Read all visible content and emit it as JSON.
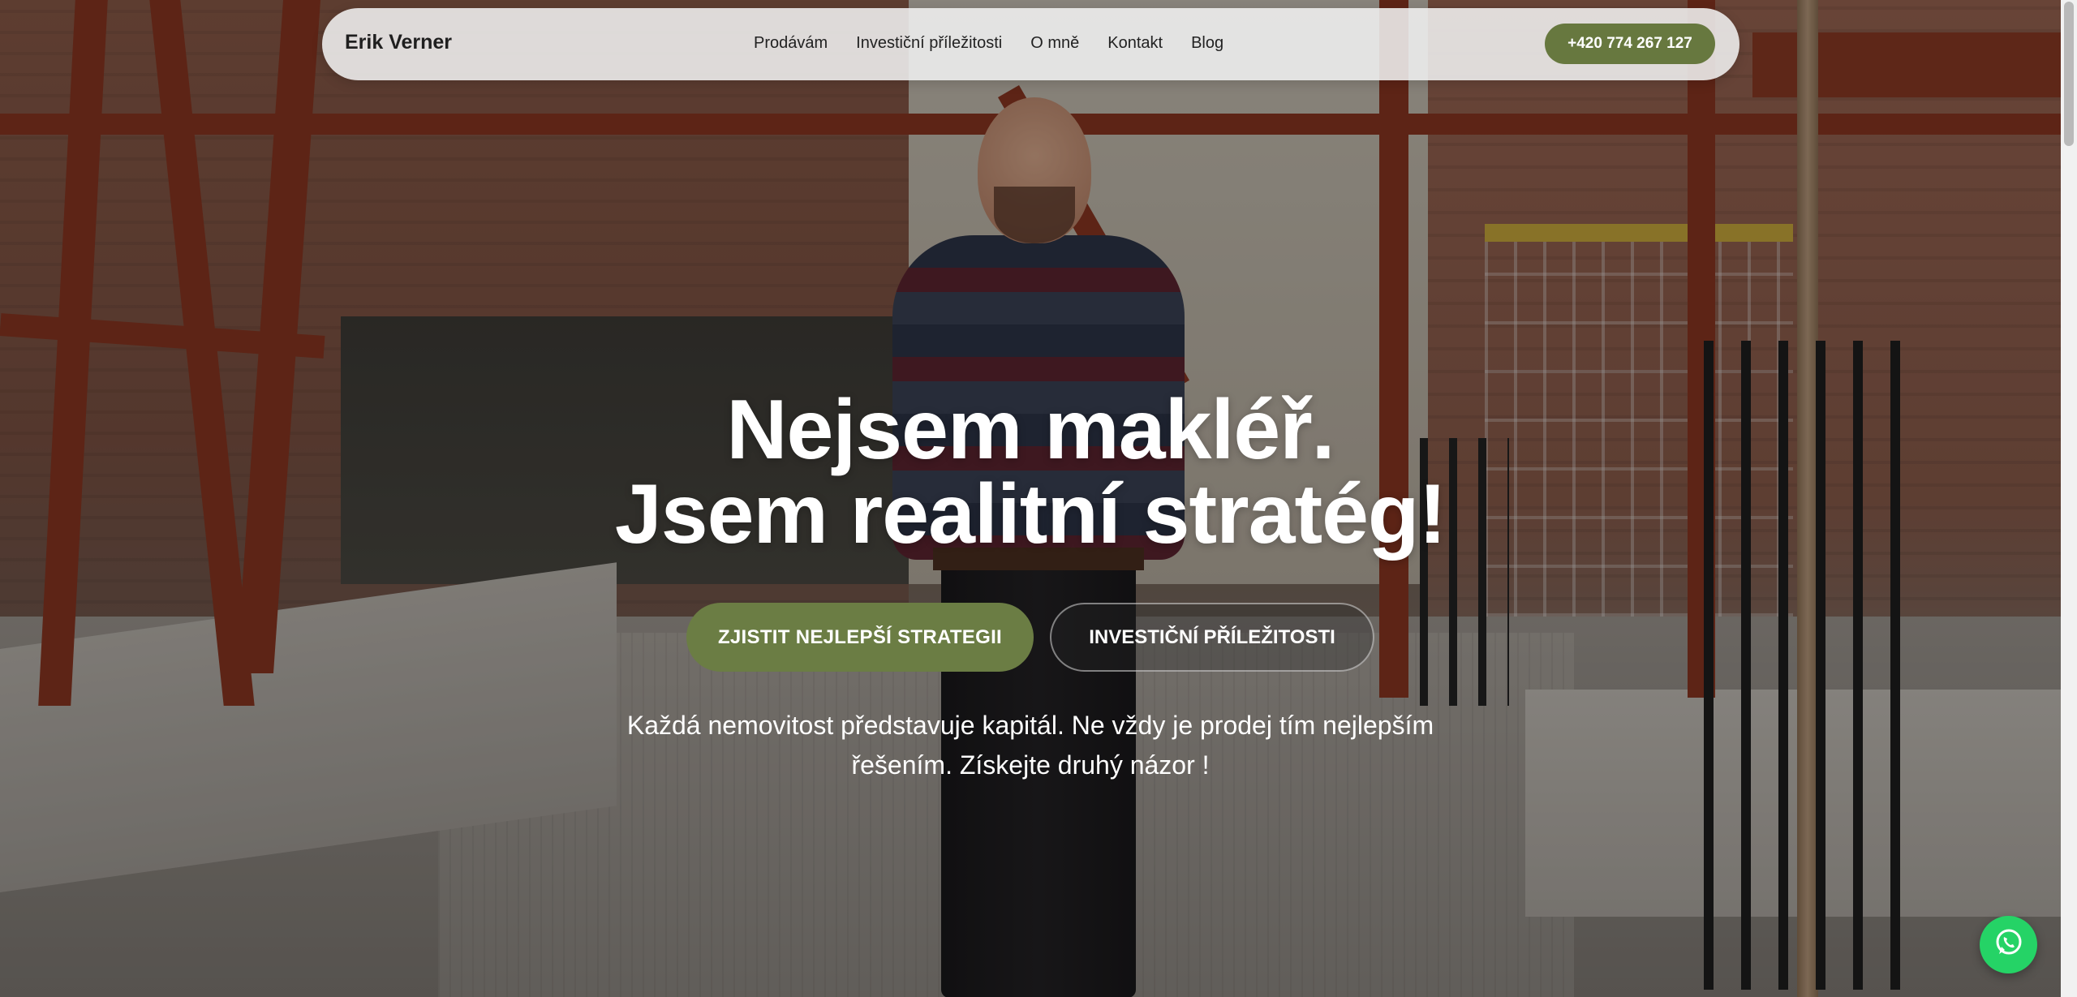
{
  "header": {
    "brand": "Erik Verner",
    "nav": [
      {
        "label": "Prodávám"
      },
      {
        "label": "Investiční příležitosti"
      },
      {
        "label": "O mně"
      },
      {
        "label": "Kontakt"
      },
      {
        "label": "Blog"
      }
    ],
    "phone": "+420 774 267 127"
  },
  "hero": {
    "headline_line1": "Nejsem makléř.",
    "headline_line2": "Jsem realitní stratég!",
    "primary_cta": "ZJISTIT NEJLEPŠÍ STRATEGII",
    "secondary_cta": "INVESTIČNÍ PŘÍLEŽITOSTI",
    "subtext": "Každá nemovitost představuje kapitál. Ne vždy je prodej tím nejlepším řešením. Získejte druhý názor !"
  },
  "colors": {
    "accent": "#67783f",
    "whatsapp": "#25d366"
  },
  "icons": {
    "chat": "whatsapp-icon"
  }
}
